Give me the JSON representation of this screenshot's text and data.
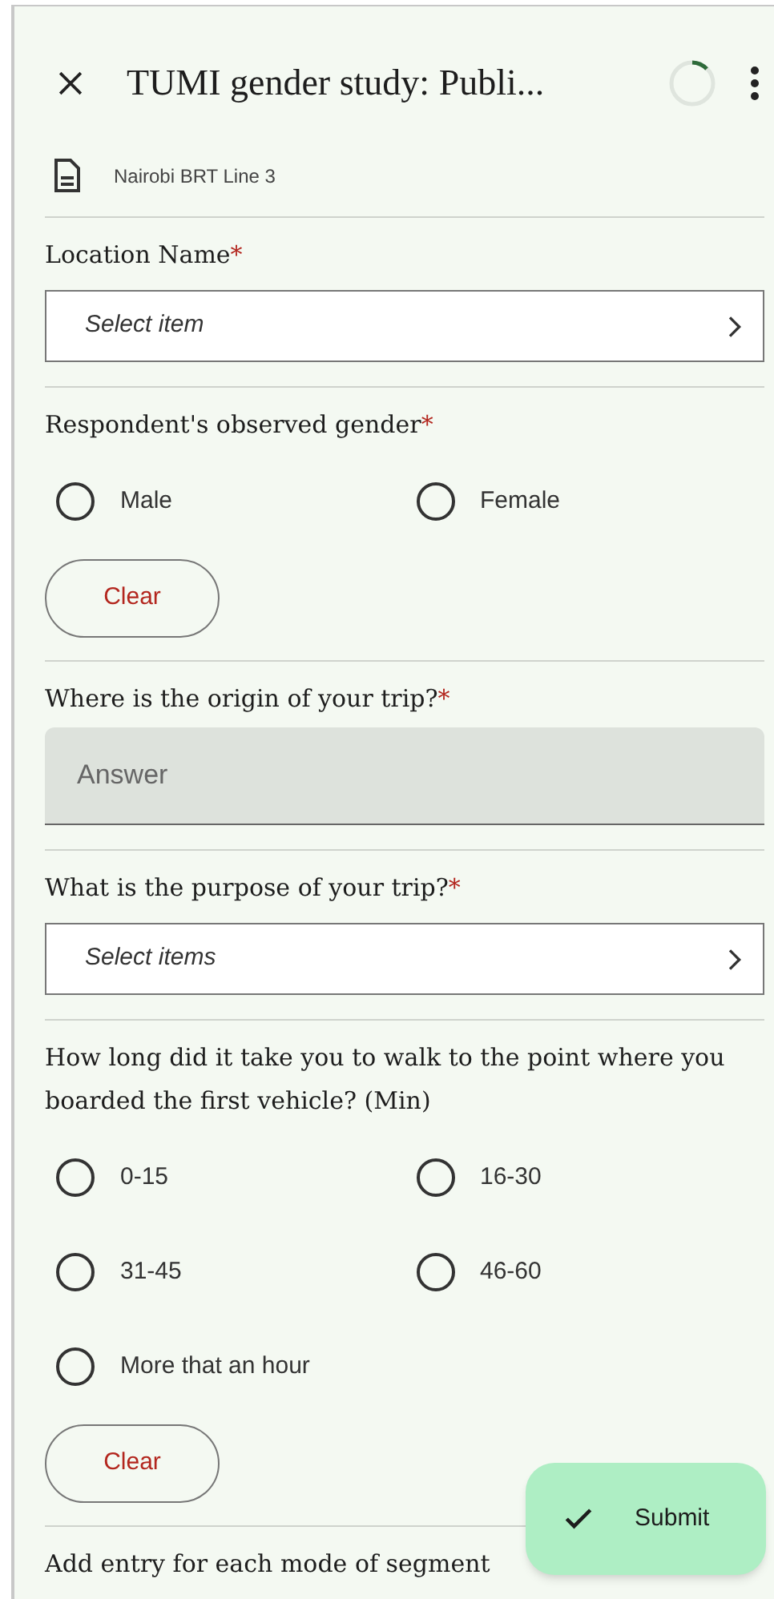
{
  "header": {
    "title": "TUMI gender study: Publi..."
  },
  "form_name": "Nairobi BRT Line 3",
  "questions": [
    {
      "kind": "select",
      "label": "Location Name",
      "required": true,
      "placeholder": "Select item"
    },
    {
      "kind": "radio",
      "label": "Respondent's observed gender",
      "required": true,
      "options": [
        {
          "label": "Male",
          "selected": false
        },
        {
          "label": "Female",
          "selected": false
        }
      ],
      "clear": "Clear"
    },
    {
      "kind": "text",
      "label": "Where is the origin of your trip?",
      "required": true,
      "placeholder": "Answer"
    },
    {
      "kind": "select",
      "label": "What is the purpose of your trip?",
      "required": true,
      "placeholder": "Select items"
    },
    {
      "kind": "radio",
      "label": "How long did it take you to walk to the point where you boarded the first vehicle? (Min)",
      "required": false,
      "options": [
        {
          "label": "0-15",
          "selected": false
        },
        {
          "label": "16-30",
          "selected": false
        },
        {
          "label": "31-45",
          "selected": false
        },
        {
          "label": "46-60",
          "selected": false
        },
        {
          "label": "More that an hour",
          "selected": false
        }
      ],
      "clear": "Clear"
    },
    {
      "kind": "note",
      "label": "Add entry for each mode of segment",
      "required": false
    }
  ],
  "required_mark": "*",
  "submit": "Submit"
}
